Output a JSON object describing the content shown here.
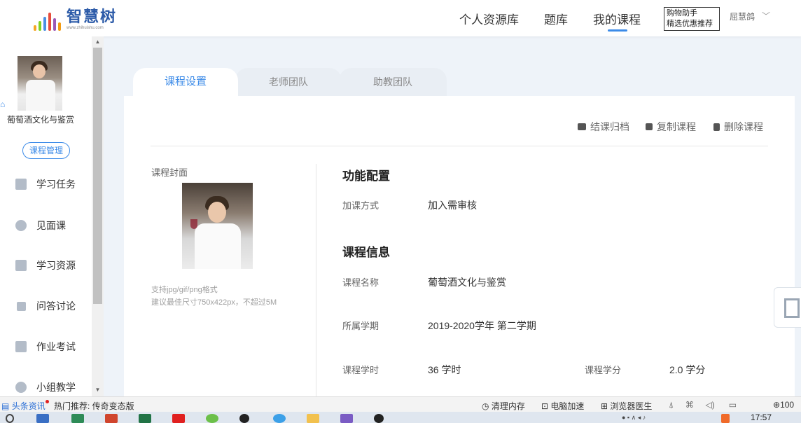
{
  "header": {
    "logo_text": "智慧树",
    "logo_url": "www.zhihuishu.com",
    "nav": [
      "个人资源库",
      "题库",
      "我的课程"
    ],
    "active_nav": "我的课程",
    "tooltip_line1": "购物助手",
    "tooltip_line2": "精选优惠推荐",
    "username": "屈慧鸽",
    "chevron": "﹀"
  },
  "sidebar": {
    "home_icon": "⌂",
    "course_name": "葡萄酒文化与鉴赏",
    "manage_label": "课程管理",
    "items": [
      {
        "label": "学习任务",
        "icon": "clipboard-icon"
      },
      {
        "label": "见面课",
        "icon": "person-icon"
      },
      {
        "label": "学习资源",
        "icon": "folder-icon"
      },
      {
        "label": "问答讨论",
        "icon": "question-icon"
      },
      {
        "label": "作业考试",
        "icon": "book-icon"
      },
      {
        "label": "小组教学",
        "icon": "group-icon"
      }
    ]
  },
  "tabs": [
    "课程设置",
    "老师团队",
    "助教团队"
  ],
  "actions": [
    "结课归档",
    "复制课程",
    "删除课程"
  ],
  "cover": {
    "label": "课程封面",
    "hint1": "支持jpg/gif/png格式",
    "hint2": "建议最佳尺寸750x422px，不超过5M"
  },
  "function_config": {
    "title": "功能配置",
    "join_label": "加课方式",
    "join_value": "加入需审核"
  },
  "course_info": {
    "title": "课程信息",
    "name_label": "课程名称",
    "name_value": "葡萄酒文化与鉴赏",
    "term_label": "所属学期",
    "term_value": "2019-2020学年  第二学期",
    "hours_label": "课程学时",
    "hours_value": "36 学时",
    "credit_label": "课程学分",
    "credit_value": "2.0 学分"
  },
  "statusbar": {
    "news": "头条资讯",
    "hot": "热门推荐: 传奇变态版",
    "clean": "清理内存",
    "speed": "电脑加速",
    "doctor": "浏览器医生",
    "zoom": "100"
  },
  "taskbar": {
    "clock": "17:57"
  },
  "colors": {
    "accent": "#3c8be8",
    "logo": "#2b5aa8",
    "page_bg": "#eef3f9"
  }
}
